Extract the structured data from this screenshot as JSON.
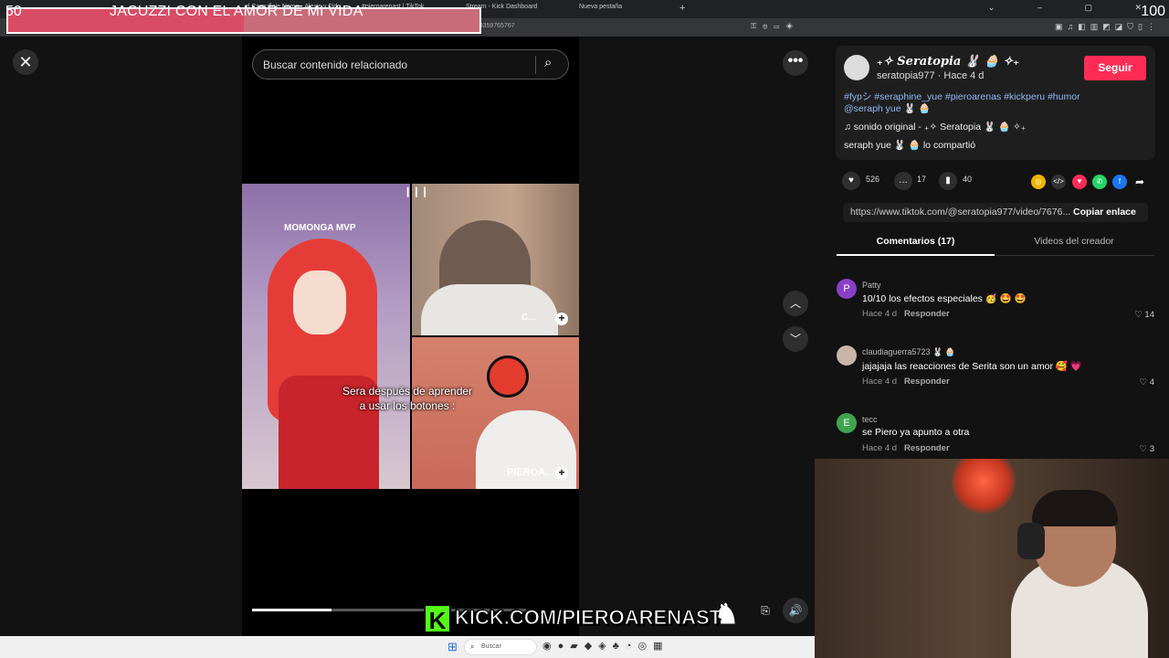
{
  "browser": {
    "tabs": [
      {
        "label": "el Camuflaje Nemo - Alexis y Fido"
      },
      {
        "label": "#pieroarenast | TikTok"
      },
      {
        "label": "Stream - Kick Dashboard"
      },
      {
        "label": "Nueva pestaña"
      }
    ],
    "new_tab": "+",
    "url": "tiktok.com/@seratopia977/video/7676924159359765767"
  },
  "overlay": {
    "left_value": "50",
    "title": "JACUZZI CON EL AMOR DE MI VIDA",
    "right_value": "100",
    "progress_fraction": 0.5,
    "fill_color": "#d94c66"
  },
  "player": {
    "close_icon": "close-icon",
    "search_placeholder": "Buscar contenido relacionado",
    "more_icon": "more-icon",
    "up_icon": "chevron-up-icon",
    "down_icon": "chevron-down-icon",
    "overlay_text_left": "MOMONGA MVP",
    "caption_line1": "Sera después de aprender",
    "caption_line2": "a usar los botones :",
    "label_top": "C...",
    "label_bottom": "PIEROA...",
    "progress_fraction": 0.29
  },
  "kick_banner": {
    "k": "K",
    "text": "KICK.COM/PIEROARENAST"
  },
  "creator": {
    "display_name": "₊✧ Seratopia 🐰 🧁 ✧₊",
    "handle": "seratopia977 · Hace 4 d",
    "follow_label": "Seguir",
    "hashtags": "#fypシ #seraphine_yue #pieroarenas #kickperu #humor",
    "mention": "@seraph yue 🐰 🧁",
    "sound": "♫  sonido original - ₊✧ Seratopia 🐰 🧁 ✧₊",
    "shared": "seraph yue 🐰 🧁 lo compartió"
  },
  "stats": {
    "likes": "526",
    "comments": "17",
    "saves": "40"
  },
  "link": {
    "url": "https://www.tiktok.com/@seratopia977/video/7676...",
    "copy_label": "Copiar enlace"
  },
  "tabs": {
    "comments": "Comentarios (17)",
    "creator_videos": "Videos del creador"
  },
  "comments": [
    {
      "initial": "P",
      "avatar_color": "#8a3fc7",
      "name": "Patty",
      "text": "10/10 los efectos especiales 🥳 🤩 🤩",
      "time": "Hace 4 d",
      "reply": "Responder",
      "likes": "14"
    },
    {
      "initial": "",
      "avatar_color": "#c9b6a8",
      "name": "claudiaguerra5723 🐰 🧁",
      "text": "jajajaja las reacciones de Serita son un amor 🥰 💗",
      "time": "Hace 4 d",
      "reply": "Responder",
      "likes": "4"
    },
    {
      "initial": "E",
      "avatar_color": "#3fa34d",
      "name": "tecc",
      "text": "se Piero ya apunto a otra",
      "time": "Hace 4 d",
      "reply": "Responder",
      "likes": "3"
    }
  ],
  "taskbar": {
    "search_label": "Buscar"
  }
}
